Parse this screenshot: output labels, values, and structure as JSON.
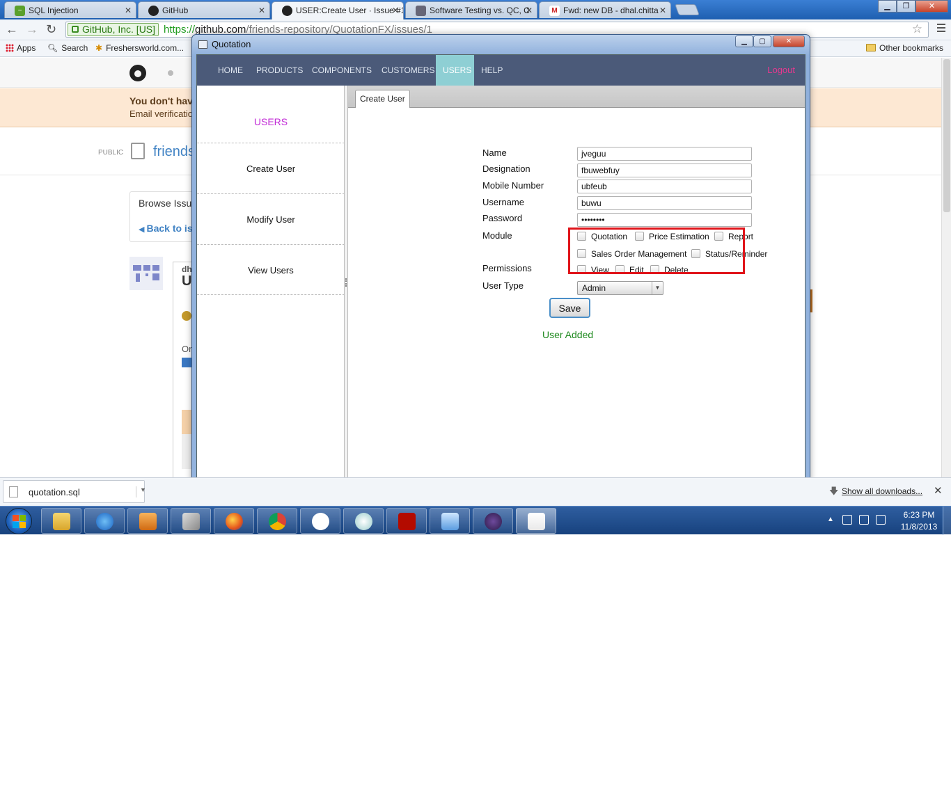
{
  "browser": {
    "tabs": [
      {
        "title": "SQL Injection",
        "favicon": "sql-icon"
      },
      {
        "title": "GitHub",
        "favicon": "github-icon"
      },
      {
        "title": "USER:Create User · Issue #1",
        "favicon": "github-icon"
      },
      {
        "title": "Software Testing vs. QC, C",
        "favicon": "page-icon"
      },
      {
        "title": "Fwd: new DB - dhal.chitta",
        "favicon": "gmail-icon"
      }
    ],
    "ev_label": "GitHub, Inc. [US]",
    "url_scheme": "https://",
    "url_host": "github.com",
    "url_path": "/friends-repository/QuotationFX/issues/1",
    "bookmarks": {
      "apps": "Apps",
      "search": "Search",
      "freshersworld": "Freshersworld.com...",
      "other": "Other bookmarks"
    }
  },
  "github": {
    "notice_title": "You don't have",
    "notice_sub": "Email verification",
    "public_label": "PUBLIC",
    "repo_name": "friends",
    "browse_label": "Browse Issu",
    "back_link": "Back to iss",
    "comment_user": "dh",
    "comment_title": "U",
    "comment_body": "Or"
  },
  "app": {
    "window_title": "Quotation",
    "nav": [
      "HOME",
      "PRODUCTS",
      "COMPONENTS",
      "CUSTOMERS",
      "USERS",
      "HELP"
    ],
    "nav_active": "USERS",
    "logout": "Logout",
    "sidebar": {
      "title": "USERS",
      "items": [
        "Create User",
        "Modify User",
        "View Users"
      ]
    },
    "tab": "Create User",
    "form": {
      "name_label": "Name",
      "name_value": "jveguu",
      "designation_label": "Designation",
      "designation_value": "fbuwebfuy",
      "mobile_label": "Mobile Number",
      "mobile_value": "ubfeub",
      "username_label": "Username",
      "username_value": "buwu",
      "password_label": "Password",
      "password_value": "••••••••",
      "module_label": "Module",
      "modules": [
        "Quotation",
        "Price Estimation",
        "Report",
        "Sales Order Management",
        "Status/Reminder"
      ],
      "permissions_label": "Permissions",
      "permissions": [
        "View",
        "Edit",
        "Delete"
      ],
      "usertype_label": "User Type",
      "usertype_value": "Admin",
      "save_label": "Save",
      "status_text": "User Added"
    },
    "colors": {
      "nav_bg": "#4b5a79",
      "nav_active": "#8ecfd4",
      "logout": "#e8388f",
      "sidebar_title": "#c12ad6",
      "status": "#1f8a1f",
      "highlight": "#e0141a"
    }
  },
  "downloads": {
    "file": "quotation.sql",
    "show_all": "Show all downloads..."
  },
  "taskbar": {
    "apps": [
      "explorer-icon",
      "ie-icon",
      "media-player-icon",
      "tools-icon",
      "firefox-icon",
      "chrome-icon",
      "gtalk-icon",
      "paint-icon",
      "acrobat-icon",
      "remote-desktop-icon",
      "java-ee-ide-icon",
      "java-icon"
    ],
    "time": "6:23 PM",
    "date": "11/8/2013"
  }
}
